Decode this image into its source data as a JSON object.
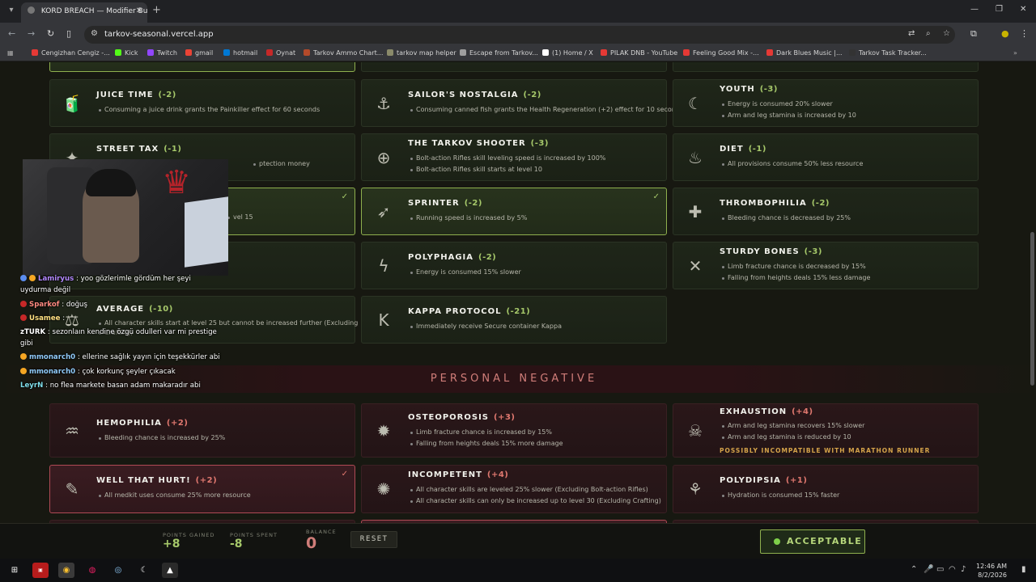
{
  "browser": {
    "tab_title": "KORD BREACH — Modifier Buil",
    "url": "tarkov-seasonal.vercel.app",
    "bookmarks": [
      {
        "label": "Cengizhan Cengiz -...",
        "color": "#e53935"
      },
      {
        "label": "Kick",
        "color": "#53fc18"
      },
      {
        "label": "Twitch",
        "color": "#9146ff"
      },
      {
        "label": "gmail",
        "color": "#ea4335"
      },
      {
        "label": "hotmail",
        "color": "#0078d4"
      },
      {
        "label": "Oynat",
        "color": "#c62828"
      },
      {
        "label": "Tarkov Ammo Chart...",
        "color": "#b34a2a"
      },
      {
        "label": "tarkov map helper",
        "color": "#8a8a6a"
      },
      {
        "label": "Escape from Tarkov...",
        "color": "#9e9e9e"
      },
      {
        "label": "(1) Home / X",
        "color": "#ffffff"
      },
      {
        "label": "PILAK DNB - YouTube",
        "color": "#e53935"
      },
      {
        "label": "Feeling Good Mix -...",
        "color": "#e53935"
      },
      {
        "label": "Dark Blues Music |...",
        "color": "#e53935"
      },
      {
        "label": "Tarkov Task Tracker...",
        "color": "#333333"
      }
    ]
  },
  "cards": {
    "juice_time": {
      "title": "JUICE TIME",
      "cost": "(-2)",
      "lines": [
        "Consuming a juice drink grants the Painkiller effect for 60 seconds"
      ]
    },
    "sailors_nostalgia": {
      "title": "SAILOR'S NOSTALGIA",
      "cost": "(-2)",
      "lines": [
        "Consuming canned fish grants the Health Regeneration (+2) effect for 10 seconds"
      ]
    },
    "youth": {
      "title": "YOUTH",
      "cost": "(-3)",
      "lines": [
        "Energy is consumed 20% slower",
        "Arm and leg stamina is increased by 10"
      ]
    },
    "street_tax": {
      "title": "STREET TAX",
      "cost": "(-1)",
      "lines": [
        "ptection money"
      ]
    },
    "tarkov_shooter": {
      "title": "THE TARKOV SHOOTER",
      "cost": "(-3)",
      "lines": [
        "Bolt-action Rifles skill leveling speed is increased by 100%",
        "Bolt-action Rifles skill starts at level 10"
      ]
    },
    "diet": {
      "title": "DIET",
      "cost": "(-1)",
      "lines": [
        "All provisions consume 50% less resource"
      ]
    },
    "hidden_selected": {
      "lines": [
        "vel 15"
      ]
    },
    "sprinter": {
      "title": "SPRINTER",
      "cost": "(-2)",
      "lines": [
        "Running speed is increased by 5%"
      ]
    },
    "thrombophilia": {
      "title": "THROMBOPHILIA",
      "cost": "(-2)",
      "lines": [
        "Bleeding chance is decreased by 25%"
      ]
    },
    "polyphagia": {
      "title": "POLYPHAGIA",
      "cost": "(-2)",
      "lines": [
        "Energy is consumed 15% slower"
      ]
    },
    "sturdy_bones": {
      "title": "STURDY BONES",
      "cost": "(-3)",
      "lines": [
        "Limb fracture chance is decreased by 15%",
        "Falling from heights deals 15% less damage"
      ]
    },
    "average": {
      "title": "AVERAGE",
      "cost": "(-10)",
      "lines": [
        "All character skills start at level 25 but cannot be increased further (Excluding",
        "Crafting)"
      ]
    },
    "kappa_protocol": {
      "title": "KAPPA PROTOCOL",
      "cost": "(-21)",
      "lines": [
        "Immediately receive Secure container Kappa"
      ]
    },
    "hemophilia": {
      "title": "HEMOPHILIA",
      "cost": "(+2)",
      "lines": [
        "Bleeding chance is increased by 25%"
      ]
    },
    "osteoporosis": {
      "title": "OSTEOPOROSIS",
      "cost": "(+3)",
      "lines": [
        "Limb fracture chance is increased by 15%",
        "Falling from heights deals 15% more damage"
      ]
    },
    "exhaustion": {
      "title": "EXHAUSTION",
      "cost": "(+4)",
      "lines": [
        "Arm and leg stamina recovers 15% slower",
        "Arm and leg stamina is reduced by 10"
      ],
      "warning": "POSSIBLY INCOMPATIBLE WITH MARATHON RUNNER"
    },
    "well_that_hurt": {
      "title": "WELL THAT HURT!",
      "cost": "(+2)",
      "lines": [
        "All medkit uses consume 25% more resource"
      ]
    },
    "incompetent": {
      "title": "INCOMPETENT",
      "cost": "(+4)",
      "lines": [
        "All character skills are leveled 25% slower (Excluding Bolt-action Rifles)",
        "All character skills can only be increased up to level 30 (Excluding Crafting)"
      ]
    },
    "polydipsia": {
      "title": "POLYDIPSIA",
      "cost": "(+1)",
      "lines": [
        "Hydration is consumed 15% faster"
      ]
    }
  },
  "check_mark": "✓",
  "section": {
    "personal_negative": "PERSONAL NEGATIVE"
  },
  "chat": [
    {
      "user": "Lamiryus",
      "color": "#b388ff",
      "text": ": yoo gözlerimle gördüm her şeyi"
    },
    {
      "user": "",
      "color": "#ffffff",
      "text": "uydurma değil"
    },
    {
      "user": "Sparkof",
      "color": "#ff8a80",
      "text": ": doğuş"
    },
    {
      "user": "Usamee",
      "color": "#ffe082",
      "text": ":"
    },
    {
      "user": "zTURK",
      "color": "#ffffff",
      "text": ": sezonlaın kendine özgü odulleri var mi prestige"
    },
    {
      "user": "",
      "color": "#ffffff",
      "text": "gibi"
    },
    {
      "user": "mmonarch0",
      "color": "#90caf9",
      "text": ": ellerine sağlık yayın için teşekkürler abi"
    },
    {
      "user": "mmonarch0",
      "color": "#90caf9",
      "text": ": çok korkunç şeyler çıkacak"
    },
    {
      "user": "LeyrN",
      "color": "#80deea",
      "text": ": no flea markete basan adam makaradır abi"
    }
  ],
  "footer": {
    "points_gained_label": "POINTS GAINED",
    "points_gained": "+8",
    "points_spent_label": "POINTS SPENT",
    "points_spent": "-8",
    "balance_label": "BALANCE",
    "balance": "0",
    "reset": "RESET",
    "accept": "ACCEPTABLE"
  },
  "taskbar": {
    "time": "12:46 AM",
    "date": "8/2/2026"
  },
  "colors": {
    "positive": "#a6c86a",
    "negative": "#e0786f",
    "warning": "#d4a34a",
    "accent_green": "#8fb04e"
  },
  "icons": [
    "juice-icon",
    "anchor-icon",
    "rabbit-icon",
    "crossbow-icon",
    "rifle-icon",
    "food-icon",
    "sprint-icon",
    "bandage-icon",
    "lightning-icon",
    "bones-icon",
    "kappa-icon",
    "blood-icon",
    "skeleton-icon",
    "tired-icon",
    "medkit-icon",
    "brain-icon",
    "water-icon"
  ]
}
